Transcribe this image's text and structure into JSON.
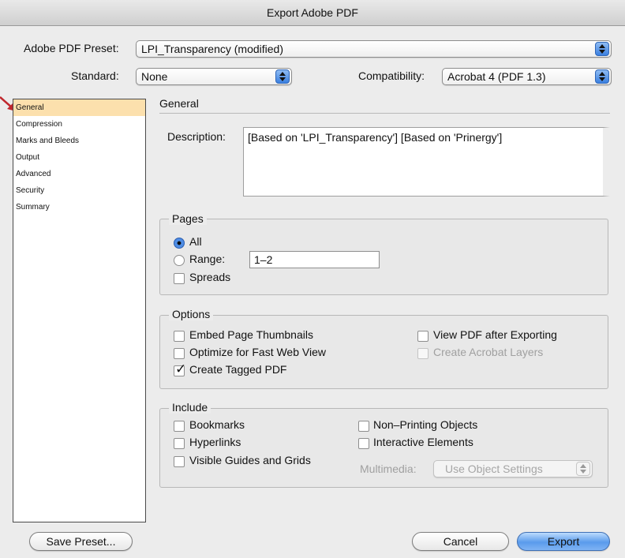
{
  "window": {
    "title": "Export Adobe PDF"
  },
  "preset": {
    "label": "Adobe PDF Preset:",
    "value": "LPI_Transparency (modified)"
  },
  "standard": {
    "label": "Standard:",
    "value": "None"
  },
  "compatibility": {
    "label": "Compatibility:",
    "value": "Acrobat 4 (PDF 1.3)"
  },
  "sidebar": {
    "items": [
      {
        "label": "General",
        "selected": true
      },
      {
        "label": "Compression"
      },
      {
        "label": "Marks and Bleeds"
      },
      {
        "label": "Output"
      },
      {
        "label": "Advanced"
      },
      {
        "label": "Security"
      },
      {
        "label": "Summary"
      }
    ]
  },
  "general": {
    "title": "General",
    "description_label": "Description:",
    "description_value": "[Based on 'LPI_Transparency'] [Based on 'Prinergy']"
  },
  "pages": {
    "title": "Pages",
    "all_label": "All",
    "range_label": "Range:",
    "range_value": "1–2",
    "spreads_label": "Spreads"
  },
  "options": {
    "title": "Options",
    "embed_thumbnails": "Embed Page Thumbnails",
    "optimize_web": "Optimize for Fast Web View",
    "create_tagged": "Create Tagged PDF",
    "view_after": "View PDF after Exporting",
    "acrobat_layers": "Create Acrobat Layers"
  },
  "include": {
    "title": "Include",
    "bookmarks": "Bookmarks",
    "hyperlinks": "Hyperlinks",
    "guides_grids": "Visible Guides and Grids",
    "non_printing": "Non–Printing Objects",
    "interactive": "Interactive Elements",
    "multimedia_label": "Multimedia:",
    "multimedia_value": "Use Object Settings"
  },
  "buttons": {
    "save_preset": "Save Preset...",
    "cancel": "Cancel",
    "export": "Export"
  },
  "colors": {
    "selection": "#fce0ad",
    "accent": "#5a9bec",
    "pointer_arrow": "#c0272d"
  }
}
